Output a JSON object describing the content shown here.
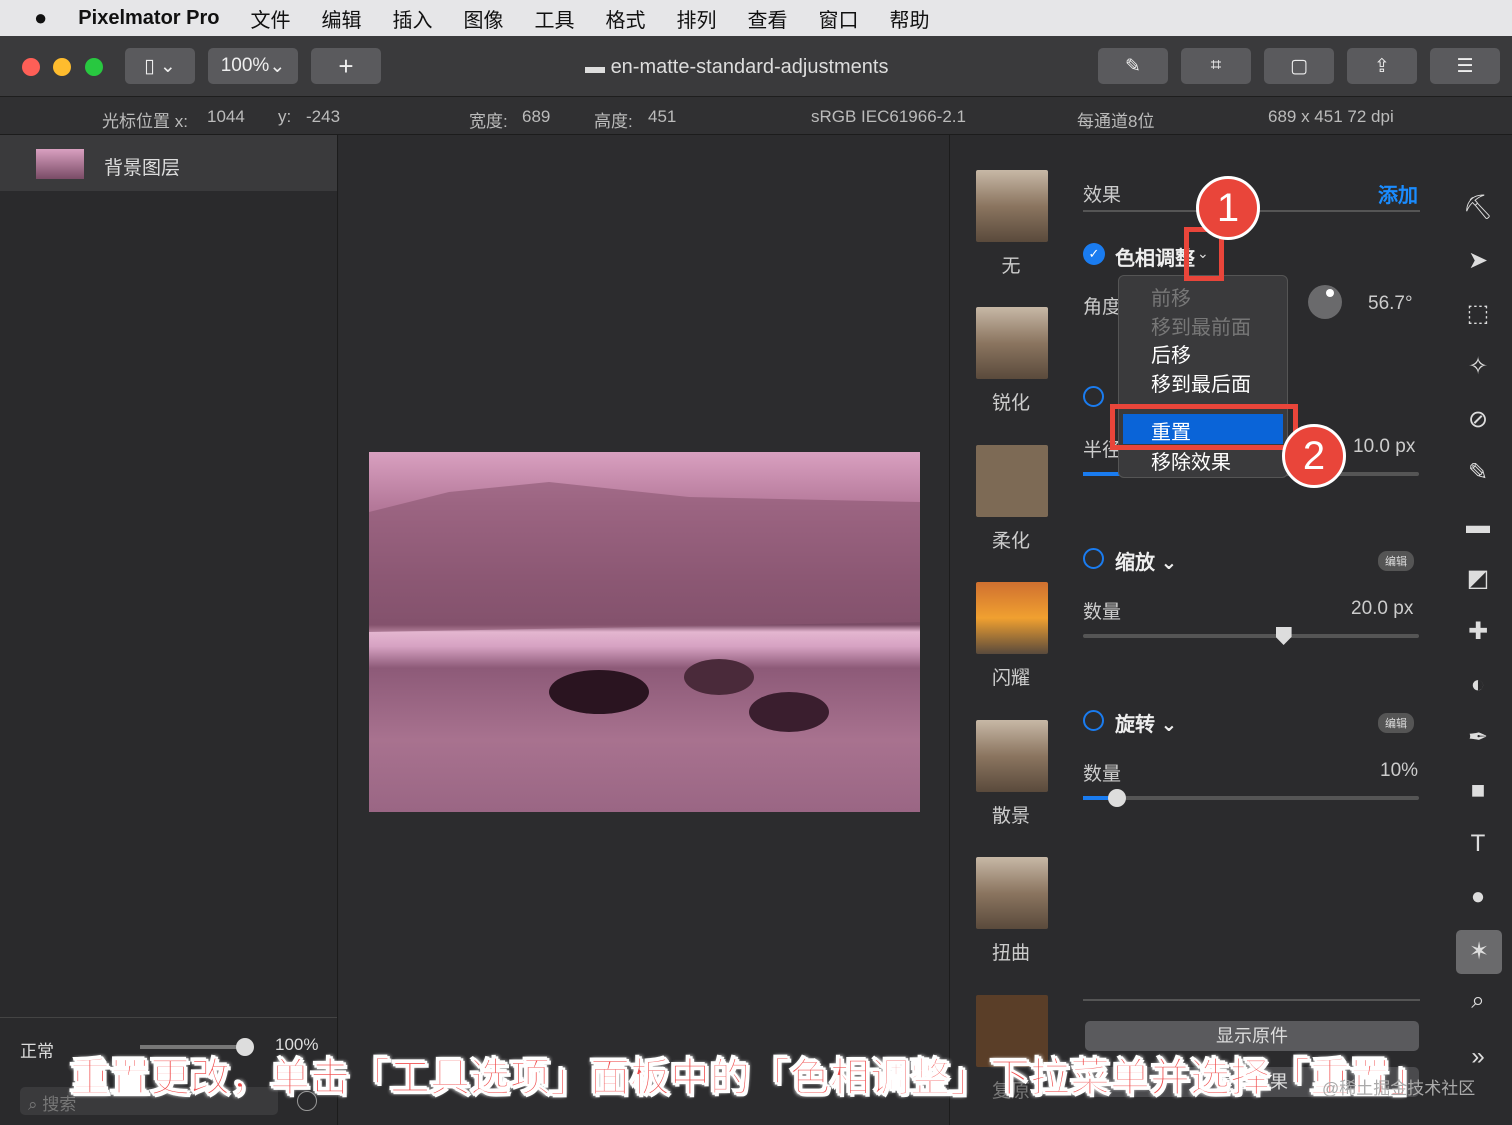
{
  "menubar": {
    "app": "Pixelmator Pro",
    "items": [
      "文件",
      "编辑",
      "插入",
      "图像",
      "工具",
      "格式",
      "排列",
      "查看",
      "窗口",
      "帮助"
    ]
  },
  "toolbar": {
    "zoom": "100%",
    "add": "+",
    "doc_title": "en-matte-standard-adjustments"
  },
  "info": {
    "cursor_x_label": "光标位置 x:",
    "cursor_x": "1044",
    "cursor_y_label": "y:",
    "cursor_y": "-243",
    "width_label": "宽度:",
    "width": "689",
    "height_label": "高度:",
    "height": "451",
    "profile": "sRGB IEC61966-2.1",
    "depth": "每通道8位",
    "dims": "689 x 451 72 dpi"
  },
  "layers": {
    "items": [
      {
        "name": "背景图层"
      }
    ],
    "blend_mode": "正常",
    "opacity": "100%",
    "search_placeholder": "搜索"
  },
  "effect_thumbs": [
    "无",
    "锐化",
    "柔化",
    "闪耀",
    "散景",
    "扭曲",
    "复原"
  ],
  "panel": {
    "title": "效果",
    "add": "添加",
    "hue": {
      "name": "色相调整",
      "angle_label": "角度",
      "angle": "56.7°"
    },
    "blur": {
      "radius_label": "半径",
      "radius": "10.0 px"
    },
    "zoom": {
      "name": "缩放",
      "edit": "编辑",
      "amount_label": "数量",
      "amount": "20.0 px",
      "slider": 0.6
    },
    "spin": {
      "name": "旋转",
      "edit": "编辑",
      "amount_label": "数量",
      "amount": "10%",
      "slider": 0.1
    },
    "show_original": "显示原件",
    "reset": "重置效果"
  },
  "menu": {
    "items": [
      "前移",
      "移到最前面",
      "后移",
      "移到最后面",
      "重置",
      "移除效果"
    ]
  },
  "annotations": {
    "badge1": "1",
    "badge2": "2",
    "caption": "重置更改，单击「工具选项」面板中的「色相调整」下拉菜单并选择「重置」",
    "watermark": "@稀土掘金技术社区"
  }
}
